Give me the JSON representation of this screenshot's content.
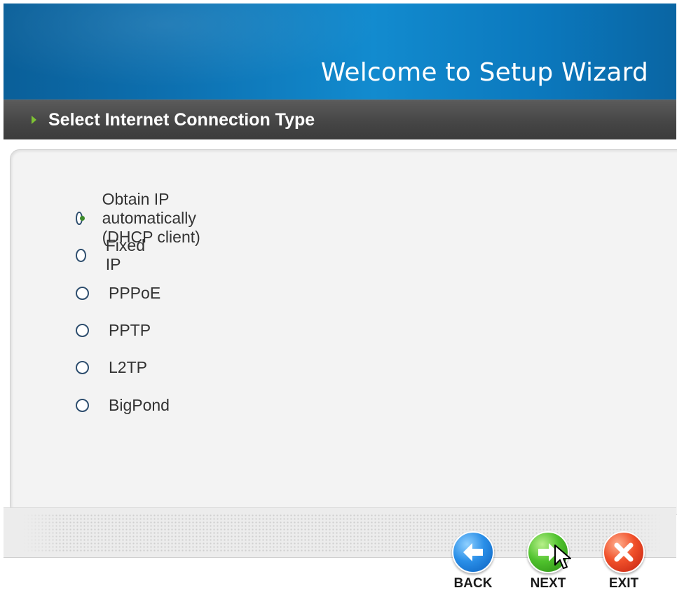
{
  "header": {
    "title": "Welcome to Setup Wizard"
  },
  "section": {
    "title": "Select Internet Connection Type"
  },
  "connection_types": {
    "selected": "Obtain IP automatically (DHCP client)",
    "options": [
      {
        "label": "Obtain IP automatically (DHCP client)",
        "checked": true
      },
      {
        "label": "Fixed IP",
        "checked": false
      },
      {
        "label": "PPPoE",
        "checked": false
      },
      {
        "label": "PPTP",
        "checked": false
      },
      {
        "label": "L2TP",
        "checked": false
      },
      {
        "label": "BigPond",
        "checked": false
      }
    ]
  },
  "buttons": {
    "back": {
      "label": "BACK",
      "icon": "arrow-left-icon",
      "color": "#1f7fd9"
    },
    "next": {
      "label": "NEXT",
      "icon": "arrow-right-icon",
      "color": "#3fb020"
    },
    "exit": {
      "label": "EXIT",
      "icon": "close-icon",
      "color": "#e03a20"
    }
  },
  "colors": {
    "header_blue": "#0d70b0",
    "section_bar": "#464646",
    "section_arrow": "#7ec234",
    "radio_border": "#2e4e6e",
    "radio_dot": "#3d8a2a"
  }
}
